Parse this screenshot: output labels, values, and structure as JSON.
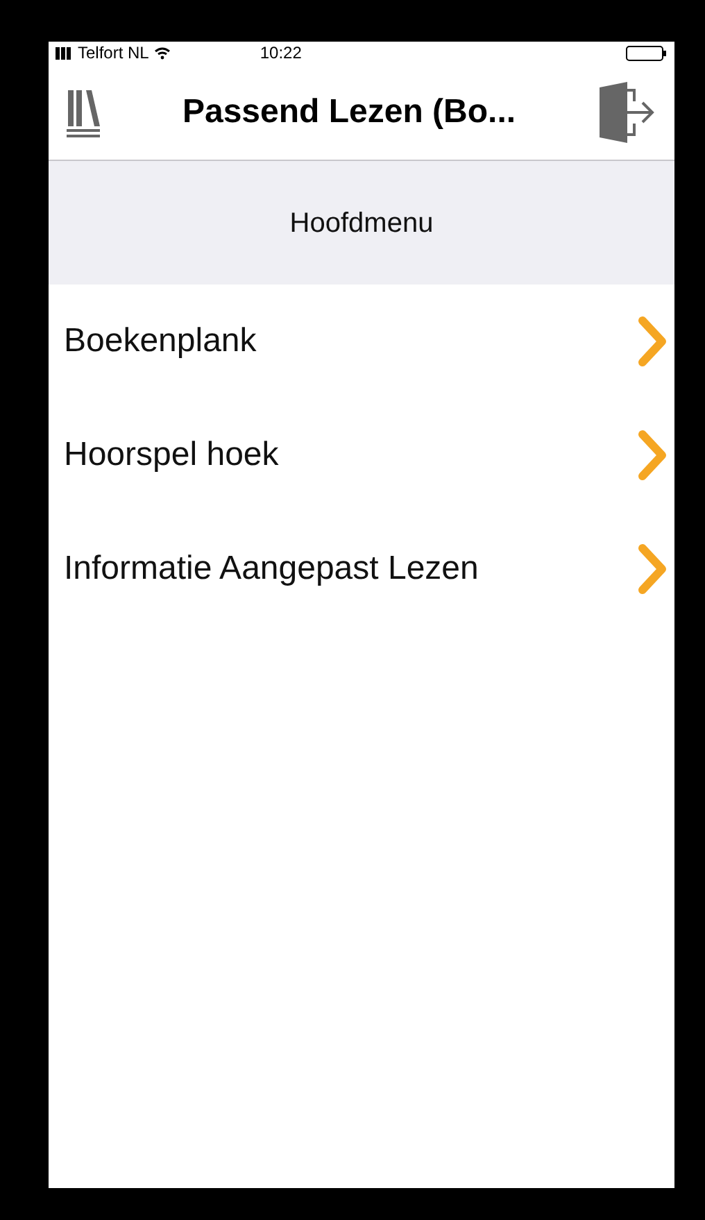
{
  "status_bar": {
    "carrier": "Telfort NL",
    "time": "10:22"
  },
  "nav_bar": {
    "title": "Passend Lezen (Bo..."
  },
  "section_header": "Hoofdmenu",
  "menu_items": [
    {
      "label": "Boekenplank"
    },
    {
      "label": "Hoorspel hoek"
    },
    {
      "label": "Informatie Aangepast Lezen"
    }
  ]
}
